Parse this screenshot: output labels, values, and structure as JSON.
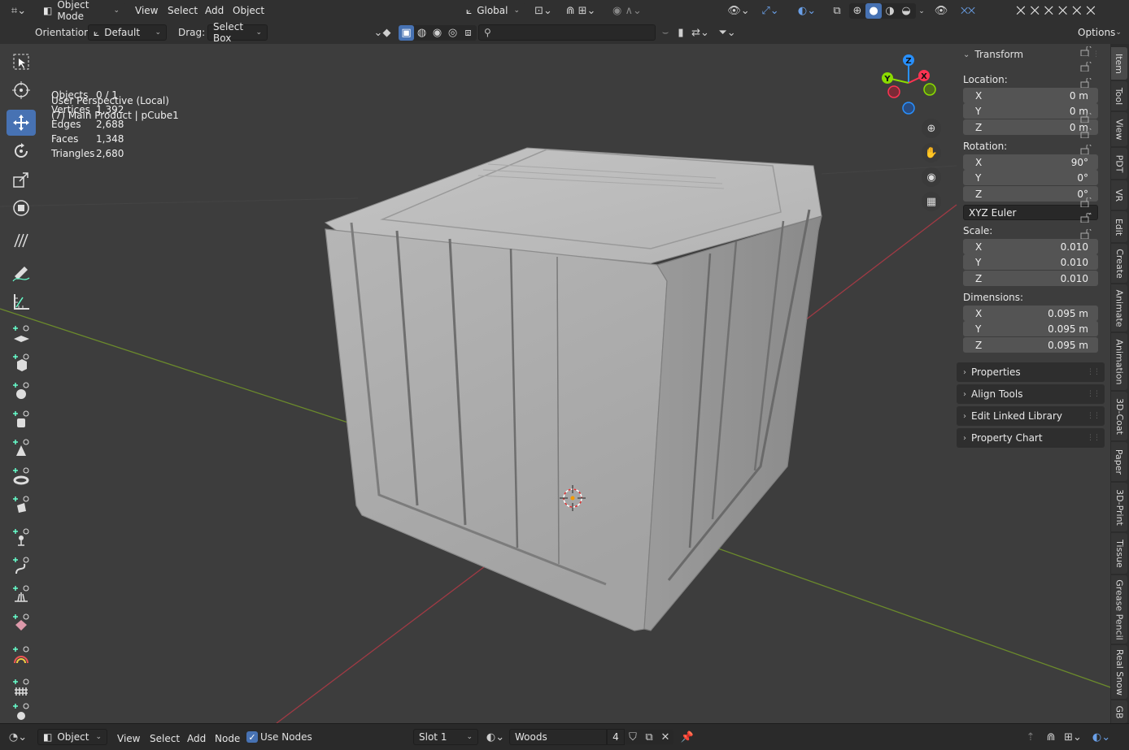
{
  "header": {
    "mode": "Object Mode",
    "menus": [
      "View",
      "Select",
      "Add",
      "Object"
    ],
    "transform_orientation": "Global",
    "options_label": "Options"
  },
  "toolheader": {
    "orientation_label": "Orientation:",
    "orientation_value": "Default",
    "drag_label": "Drag:",
    "drag_value": "Select Box"
  },
  "viewport": {
    "perspective": "User Perspective (Local)",
    "collection": "(7) Main Product | pCube1",
    "stats": [
      {
        "label": "Objects",
        "value": "0 / 1"
      },
      {
        "label": "Vertices",
        "value": "1,392"
      },
      {
        "label": "Edges",
        "value": "2,688"
      },
      {
        "label": "Faces",
        "value": "1,348"
      },
      {
        "label": "Triangles",
        "value": "2,680"
      }
    ],
    "gizmo": {
      "x": "X",
      "y": "Y",
      "z": "Z"
    }
  },
  "sidebar": {
    "transform_title": "Transform",
    "location_label": "Location:",
    "location": [
      {
        "axis": "X",
        "value": "0 m"
      },
      {
        "axis": "Y",
        "value": "0 m"
      },
      {
        "axis": "Z",
        "value": "0 m"
      }
    ],
    "rotation_label": "Rotation:",
    "rotation": [
      {
        "axis": "X",
        "value": "90°"
      },
      {
        "axis": "Y",
        "value": "0°"
      },
      {
        "axis": "Z",
        "value": "0°"
      }
    ],
    "rotation_mode": "XYZ Euler",
    "scale_label": "Scale:",
    "scale": [
      {
        "axis": "X",
        "value": "0.010"
      },
      {
        "axis": "Y",
        "value": "0.010"
      },
      {
        "axis": "Z",
        "value": "0.010"
      }
    ],
    "dimensions_label": "Dimensions:",
    "dimensions": [
      {
        "axis": "X",
        "value": "0.095 m"
      },
      {
        "axis": "Y",
        "value": "0.095 m"
      },
      {
        "axis": "Z",
        "value": "0.095 m"
      }
    ],
    "panels": [
      "Properties",
      "Align Tools",
      "Edit Linked Library",
      "Property Chart"
    ]
  },
  "tabs": [
    "Item",
    "Tool",
    "View",
    "PDT",
    "VR",
    "Edit",
    "Create",
    "Animate",
    "Animation",
    "3D-Coat",
    "Paper",
    "3D-Print",
    "Tissue",
    "Grease Pencil",
    "Real Snow",
    "GB"
  ],
  "footer": {
    "context": "Object",
    "menus": [
      "View",
      "Select",
      "Add",
      "Node"
    ],
    "use_nodes_label": "Use Nodes",
    "slot": "Slot 1",
    "material": "Woods",
    "users": "4"
  },
  "colors": {
    "accent": "#4772b3",
    "axis_x": "#ff3352",
    "axis_y": "#8bdc00",
    "axis_z": "#2890ff"
  }
}
